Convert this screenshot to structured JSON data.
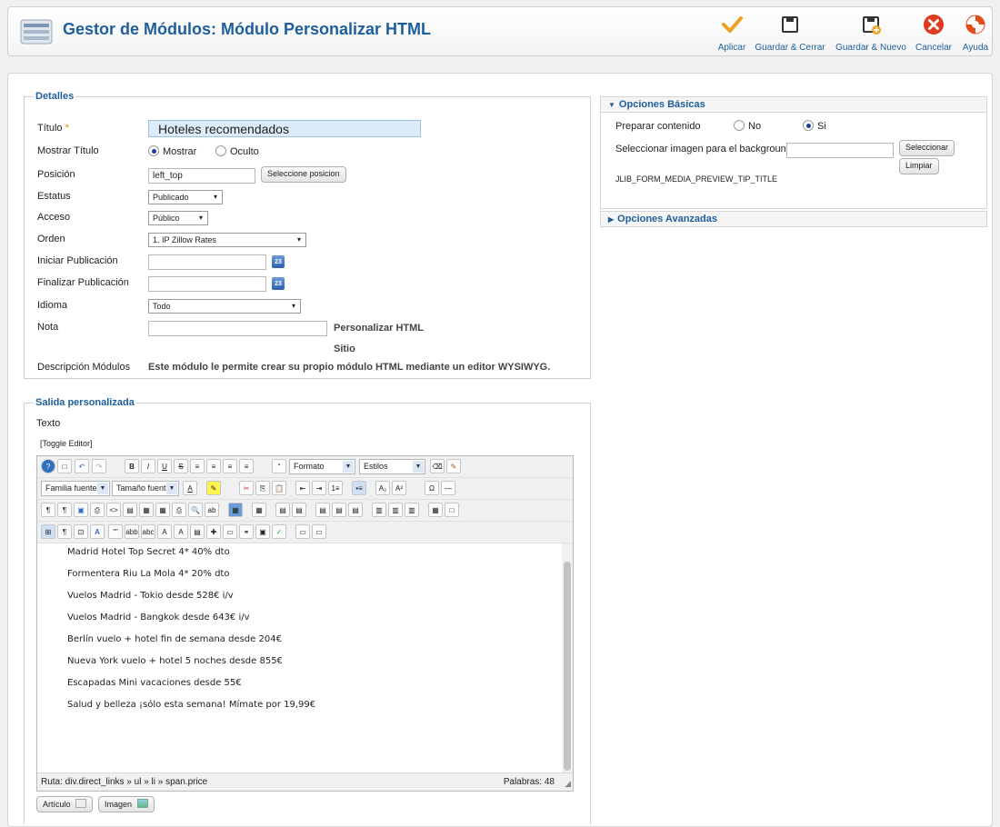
{
  "header": {
    "title": "Gestor de Módulos: Módulo Personalizar HTML",
    "buttons": [
      {
        "label": "Aplicar",
        "icon": "check-icon"
      },
      {
        "label": "Guardar & Cerrar",
        "icon": "save-icon"
      },
      {
        "label": "Guardar & Nuevo",
        "icon": "save-new-icon"
      },
      {
        "label": "Cancelar",
        "icon": "cancel-icon"
      },
      {
        "label": "Ayuda",
        "icon": "help-lifebuoy-icon"
      }
    ]
  },
  "details": {
    "legend": "Detalles",
    "title_label": "Título",
    "title_required": "*",
    "title_value": "Hoteles recomendados",
    "show_title_label": "Mostrar Título",
    "show_title_options": [
      "Mostrar",
      "Oculto"
    ],
    "position_label": "Posición",
    "position_value": "left_top",
    "position_button": "Seleccione posicion",
    "status_label": "Estatus",
    "status_value": "Publicado",
    "access_label": "Acceso",
    "access_value": "Público",
    "order_label": "Orden",
    "order_value": "1. IP Zillow Rates",
    "start_label": "Iniciar Publicación",
    "end_label": "Finalizar Publicación",
    "calendar_text": "23",
    "language_label": "Idioma",
    "language_value": "Todo",
    "note_label": "Nota",
    "module_type_label": "Personalizar HTML",
    "site_label": "Sitio",
    "desc_label": "Descripción Módulos",
    "desc_value": "Este módulo le permite crear su propio módulo HTML mediante un editor WYSIWYG."
  },
  "basic_options": {
    "header": "Opciones Básicas",
    "prepare_label": "Preparar contenido",
    "prepare_options": [
      "No",
      "Si"
    ],
    "bg_label": "Seleccionar imagen para el background",
    "select_button": "Seleccionar",
    "clear_button": "Limpiar",
    "preview_tip": "JLIB_FORM_MEDIA_PREVIEW_TIP_TITLE"
  },
  "advanced_options": {
    "header": "Opciones Avanzadas"
  },
  "output": {
    "legend": "Salida personalizada",
    "text_label": "Texto",
    "toggle_editor": "[Toggle Editor]",
    "toolbar": {
      "format": "Formato",
      "styles": "Estilos",
      "font_family": "Familia fuente",
      "font_size": "Tamaño fuente"
    },
    "content_lines": [
      "Madrid Hotel Top Secret 4* 40% dto",
      "Formentera Riu La Mola 4* 20% dto",
      "Vuelos Madrid - Tokio desde 528€ i/v",
      "Vuelos Madrid - Bangkok desde 643€ i/v",
      "Berlín vuelo + hotel fin de semana desde 204€",
      "Nueva York vuelo + hotel 5 noches desde 855€",
      "Escapadas Mini vacaciones desde 55€",
      "Salud y belleza ¡sólo esta semana! Mímate por 19,99€"
    ],
    "path": "Ruta:  div.direct_links » ul » li » span.price",
    "words": "Palabras: 48",
    "article_button": "Artículo",
    "image_button": "Imagen"
  },
  "colors": {
    "brand_blue": "#1d5e9b",
    "apply_orange": "#f0a020",
    "cancel_red": "#e03a1e"
  }
}
